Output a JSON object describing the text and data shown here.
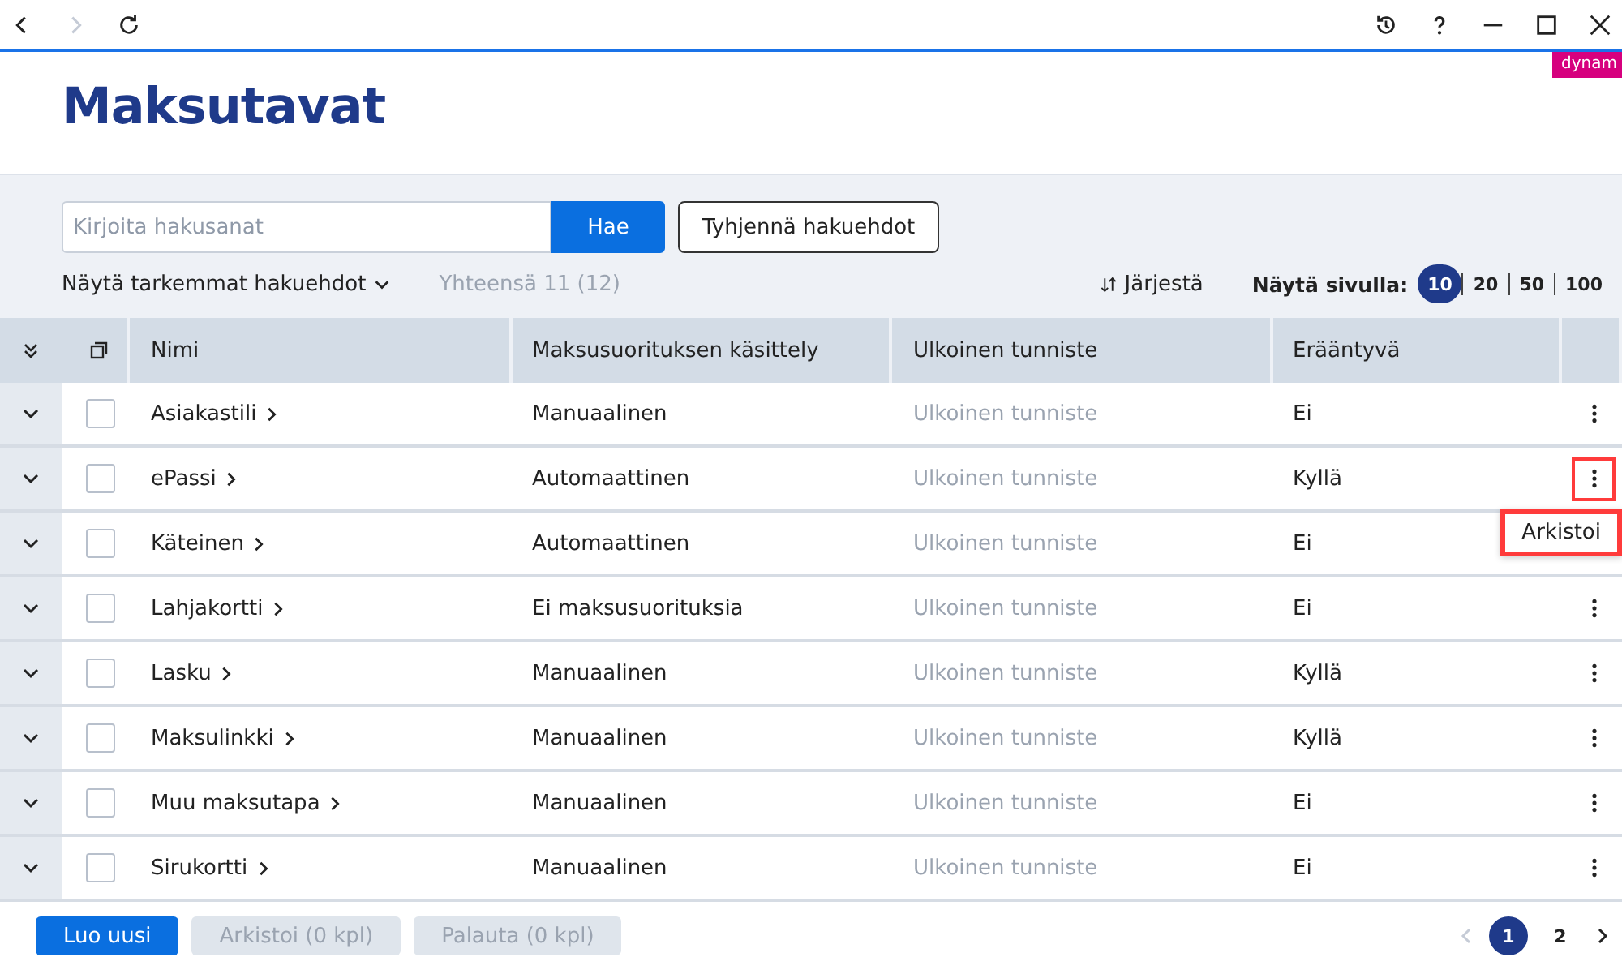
{
  "badge": "dynam",
  "title": "Maksutavat",
  "search": {
    "placeholder": "Kirjoita hakusanat",
    "button": "Hae",
    "clear": "Tyhjennä hakuehdot"
  },
  "filters_toggle": "Näytä tarkemmat hakuehdot",
  "total": "Yhteensä 11 (12)",
  "sort": "Järjestä",
  "page_size": {
    "label": "Näytä sivulla:",
    "options": [
      {
        "label": "10",
        "selected": true
      },
      {
        "label": "20",
        "selected": false
      },
      {
        "label": "50",
        "selected": false
      },
      {
        "label": "100",
        "selected": false
      }
    ]
  },
  "table": {
    "columns": [
      "Nimi",
      "Maksusuorituksen käsittely",
      "Ulkoinen tunniste",
      "Erääntyvä"
    ],
    "rows": [
      {
        "name": "Asiakastili",
        "handling": "Manuaalinen",
        "external": "Ulkoinen tunniste",
        "due": "Ei",
        "checked": false,
        "menu_open": false
      },
      {
        "name": "ePassi",
        "handling": "Automaattinen",
        "external": "Ulkoinen tunniste",
        "due": "Kyllä",
        "checked": false,
        "menu_open": true
      },
      {
        "name": "Käteinen",
        "handling": "Automaattinen",
        "external": "Ulkoinen tunniste",
        "due": "Ei",
        "checked": false,
        "menu_open": false
      },
      {
        "name": "Lahjakortti",
        "handling": "Ei maksusuorituksia",
        "external": "Ulkoinen tunniste",
        "due": "Ei",
        "checked": false,
        "menu_open": false
      },
      {
        "name": "Lasku",
        "handling": "Manuaalinen",
        "external": "Ulkoinen tunniste",
        "due": "Kyllä",
        "checked": false,
        "menu_open": false
      },
      {
        "name": "Maksulinkki",
        "handling": "Manuaalinen",
        "external": "Ulkoinen tunniste",
        "due": "Kyllä",
        "checked": false,
        "menu_open": false
      },
      {
        "name": "Muu maksutapa",
        "handling": "Manuaalinen",
        "external": "Ulkoinen tunniste",
        "due": "Ei",
        "checked": false,
        "menu_open": false
      },
      {
        "name": "Sirukortti",
        "handling": "Manuaalinen",
        "external": "Ulkoinen tunniste",
        "due": "Ei",
        "checked": false,
        "menu_open": false
      }
    ]
  },
  "row_menu": [
    "Arkistoi"
  ],
  "footer": {
    "buttons": [
      {
        "label": "Luo uusi",
        "disabled": false
      },
      {
        "label": "Arkistoi (0 kpl)",
        "disabled": true
      },
      {
        "label": "Palauta (0 kpl)",
        "disabled": true
      }
    ],
    "pages": [
      {
        "label": "1",
        "selected": true
      },
      {
        "label": "2",
        "selected": false
      }
    ]
  }
}
